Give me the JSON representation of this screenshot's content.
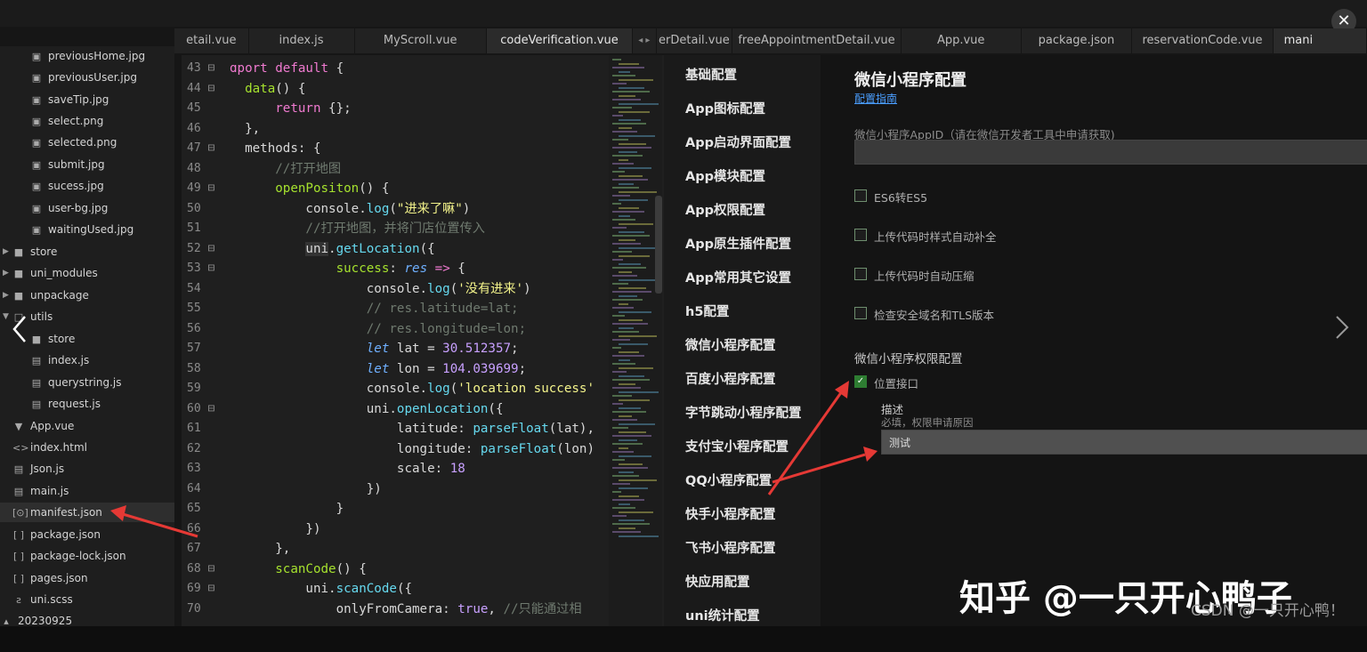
{
  "window": {
    "close_icon": "close-icon"
  },
  "tabs": [
    {
      "label": "etail.vue",
      "active": false
    },
    {
      "label": "index.js",
      "active": false
    },
    {
      "label": "MyScroll.vue",
      "active": false
    },
    {
      "label": "codeVerification.vue",
      "active": true
    },
    {
      "label": "◂ ▸",
      "active": false
    },
    {
      "label": "erDetail.vue",
      "active": false
    },
    {
      "label": "freeAppointmentDetail.vue",
      "active": false
    },
    {
      "label": "App.vue",
      "active": false
    },
    {
      "label": "package.json",
      "active": false
    },
    {
      "label": "reservationCode.vue",
      "active": false
    },
    {
      "label": "mani",
      "active": true
    }
  ],
  "sidebar": {
    "items": [
      {
        "label": "previousHome.jpg",
        "icon": "image-file-icon"
      },
      {
        "label": "previousUser.jpg",
        "icon": "image-file-icon"
      },
      {
        "label": "saveTip.jpg",
        "icon": "image-file-icon"
      },
      {
        "label": "select.png",
        "icon": "image-file-icon"
      },
      {
        "label": "selected.png",
        "icon": "image-file-icon"
      },
      {
        "label": "submit.jpg",
        "icon": "image-file-icon"
      },
      {
        "label": "sucess.jpg",
        "icon": "image-file-icon"
      },
      {
        "label": "user-bg.jpg",
        "icon": "image-file-icon"
      },
      {
        "label": "waitingUsed.jpg",
        "icon": "image-file-icon"
      },
      {
        "label": "store",
        "icon": "folder-icon"
      },
      {
        "label": "uni_modules",
        "icon": "folder-icon"
      },
      {
        "label": "unpackage",
        "icon": "folder-icon"
      },
      {
        "label": "utils",
        "icon": "folder-open-icon"
      },
      {
        "label": "store",
        "icon": "folder-icon"
      },
      {
        "label": "index.js",
        "icon": "js-file-icon"
      },
      {
        "label": "querystring.js",
        "icon": "js-file-icon"
      },
      {
        "label": "request.js",
        "icon": "js-file-icon"
      },
      {
        "label": "App.vue",
        "icon": "vue-file-icon"
      },
      {
        "label": "index.html",
        "icon": "html-file-icon"
      },
      {
        "label": "Json.js",
        "icon": "js-file-icon"
      },
      {
        "label": "main.js",
        "icon": "js-file-icon"
      },
      {
        "label": "manifest.json",
        "icon": "manifest-file-icon"
      },
      {
        "label": "package.json",
        "icon": "json-file-icon"
      },
      {
        "label": "package-lock.json",
        "icon": "json-file-icon"
      },
      {
        "label": "pages.json",
        "icon": "json-file-icon"
      },
      {
        "label": "uni.scss",
        "icon": "scss-file-icon"
      },
      {
        "label": "20230925",
        "icon": "project-icon"
      }
    ],
    "selected": "manifest.json"
  },
  "editor": {
    "line_numbers": [
      "43",
      "44",
      "45",
      "46",
      "47",
      "48",
      "49",
      "50",
      "51",
      "52",
      "53",
      "54",
      "55",
      "56",
      "57",
      "58",
      "59",
      "60",
      "61",
      "62",
      "63",
      "64",
      "65",
      "66",
      "67",
      "68",
      "69",
      "70"
    ]
  },
  "config_nav": {
    "items": [
      "基础配置",
      "App图标配置",
      "App启动界面配置",
      "App模块配置",
      "App权限配置",
      "App原生插件配置",
      "App常用其它设置",
      "h5配置",
      "微信小程序配置",
      "百度小程序配置",
      "字节跳动小程序配置",
      "支付宝小程序配置",
      "QQ小程序配置",
      "快手小程序配置",
      "飞书小程序配置",
      "快应用配置",
      "uni统计配置"
    ]
  },
  "config_panel": {
    "title": "微信小程序配置",
    "guide_link": "配置指南",
    "appid_label": "微信小程序AppID（请在微信开发者工具中申请获取)",
    "appid_value": "",
    "checkboxes": [
      {
        "label": "ES6转ES5",
        "checked": false
      },
      {
        "label": "上传代码时样式自动补全",
        "checked": false
      },
      {
        "label": "上传代码时自动压缩",
        "checked": false
      },
      {
        "label": "检查安全域名和TLS版本",
        "checked": false
      }
    ],
    "permission_header": "微信小程序权限配置",
    "location_label": "位置接口",
    "location_checked": true,
    "desc_label": "描述",
    "desc_hint": "必填，权限申请原因",
    "desc_value": "测试"
  },
  "watermark": {
    "main": "知乎 @一只开心鸭子",
    "sub": "CSDN @一只开心鸭！"
  },
  "colors": {
    "accent": "#4a9eff",
    "arrow": "#e53935",
    "check": "#2e7d32"
  }
}
